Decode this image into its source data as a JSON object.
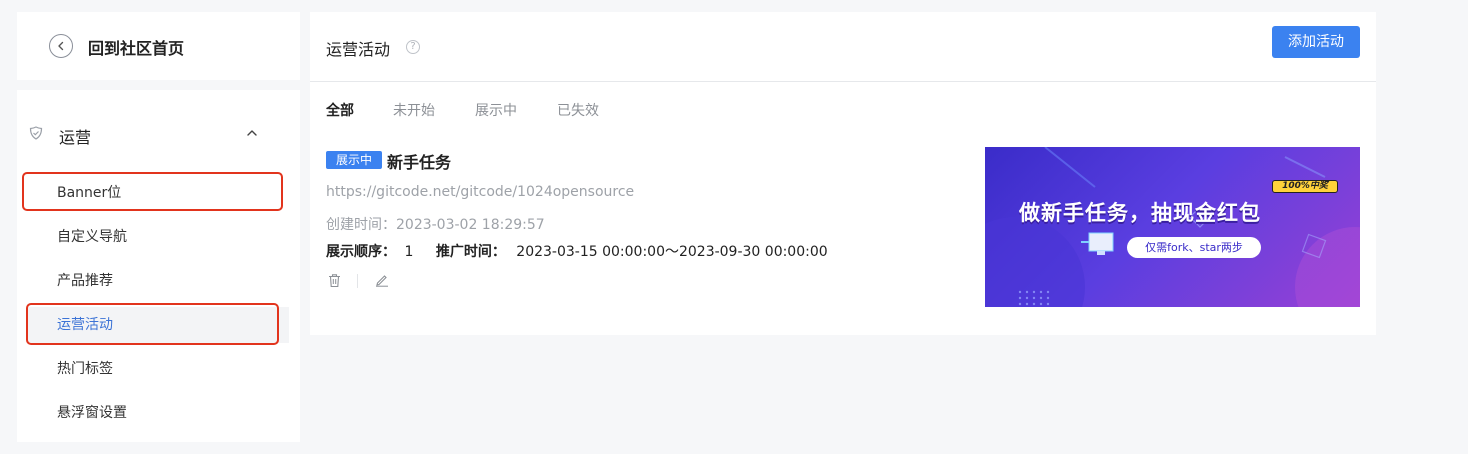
{
  "sidebar": {
    "back_label": "回到社区首页",
    "group_label": "运营",
    "items": [
      {
        "label": "Banner位"
      },
      {
        "label": "自定义导航"
      },
      {
        "label": "产品推荐"
      },
      {
        "label": "运营活动"
      },
      {
        "label": "热门标签"
      },
      {
        "label": "悬浮窗设置"
      }
    ],
    "active_index": 3
  },
  "main": {
    "title": "运营活动",
    "help_glyph": "?",
    "add_button": "添加活动",
    "tabs": [
      {
        "label": "全部"
      },
      {
        "label": "未开始"
      },
      {
        "label": "展示中"
      },
      {
        "label": "已失效"
      }
    ],
    "activity": {
      "badge": "展示中",
      "title": "新手任务",
      "url": "https://gitcode.net/gitcode/1024opensource",
      "created_label": "创建时间：",
      "created_value": "2023-03-02 18:29:57",
      "order_label": "展示顺序：",
      "order_value": "1",
      "promo_label": "推广时间：",
      "promo_value": "2023-03-15 00:00:00～2023-09-30 00:00:00"
    },
    "banner": {
      "headline": "做新手任务，抽现金红包",
      "tag": "100%中奖",
      "pill": "仅需fork、star两步"
    }
  },
  "colors": {
    "accent": "#3b82f0",
    "highlight": "#e2341d",
    "active_text": "#3c73d6"
  }
}
